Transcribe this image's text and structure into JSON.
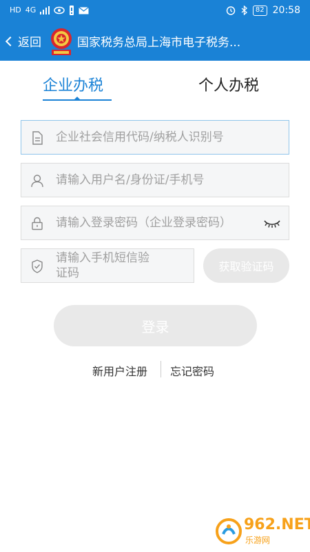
{
  "status_bar": {
    "carrier_label": "HD",
    "network_label": "4G",
    "battery_level": "82",
    "time": "20:58"
  },
  "header": {
    "back_label": "返回",
    "title": "国家税务总局上海市电子税务..."
  },
  "tabs": [
    {
      "label": "企业办税",
      "active": true
    },
    {
      "label": "个人办税",
      "active": false
    }
  ],
  "form": {
    "taxpayer_id_placeholder": "企业社会信用代码/纳税人识别号",
    "username_placeholder": "请输入用户名/身份证/手机号",
    "password_placeholder": "请输入登录密码（企业登录密码）",
    "sms_code_placeholder": "请输入手机短信验证码",
    "sms_button_label": "获取验证码",
    "login_button_label": "登录"
  },
  "links": {
    "register_label": "新用户注册",
    "forgot_password_label": "忘记密码"
  },
  "watermark": {
    "brand_main": "962.NET",
    "brand_sub": "乐游网"
  },
  "colors": {
    "primary": "#1a82d6",
    "placeholder": "#a0a0a0",
    "disabled_button": "#e9e9e9",
    "watermark": "#f7a11a"
  },
  "icons": {
    "taxpayer_id": "document-icon",
    "username": "user-icon",
    "password": "lock-icon",
    "sms_code": "shield-check-icon",
    "password_toggle": "eye-closed-icon"
  }
}
